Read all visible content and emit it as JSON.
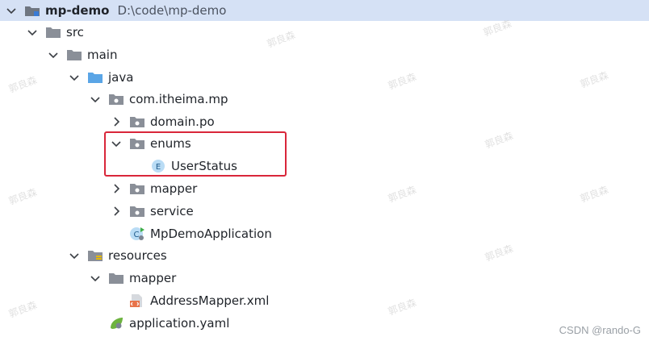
{
  "tree": {
    "root": {
      "label": "mp-demo",
      "path": "D:\\code\\mp-demo"
    },
    "items": [
      {
        "label": "src"
      },
      {
        "label": "main"
      },
      {
        "label": "java"
      },
      {
        "label": "com.itheima.mp"
      },
      {
        "label": "domain.po"
      },
      {
        "label": "enums"
      },
      {
        "label": "UserStatus",
        "badge": "E"
      },
      {
        "label": "mapper"
      },
      {
        "label": "service"
      },
      {
        "label": "MpDemoApplication",
        "badge": "C"
      },
      {
        "label": "resources"
      },
      {
        "label": "mapper"
      },
      {
        "label": "AddressMapper.xml"
      },
      {
        "label": "application.yaml"
      }
    ]
  },
  "watermark": "郭良森",
  "footer": {
    "credit": "CSDN @rando-G"
  },
  "colors": {
    "selection": "#d5e1f5",
    "highlight_box": "#d9263a",
    "folder": "#8a8f98",
    "java_folder": "#5aa5e6"
  }
}
